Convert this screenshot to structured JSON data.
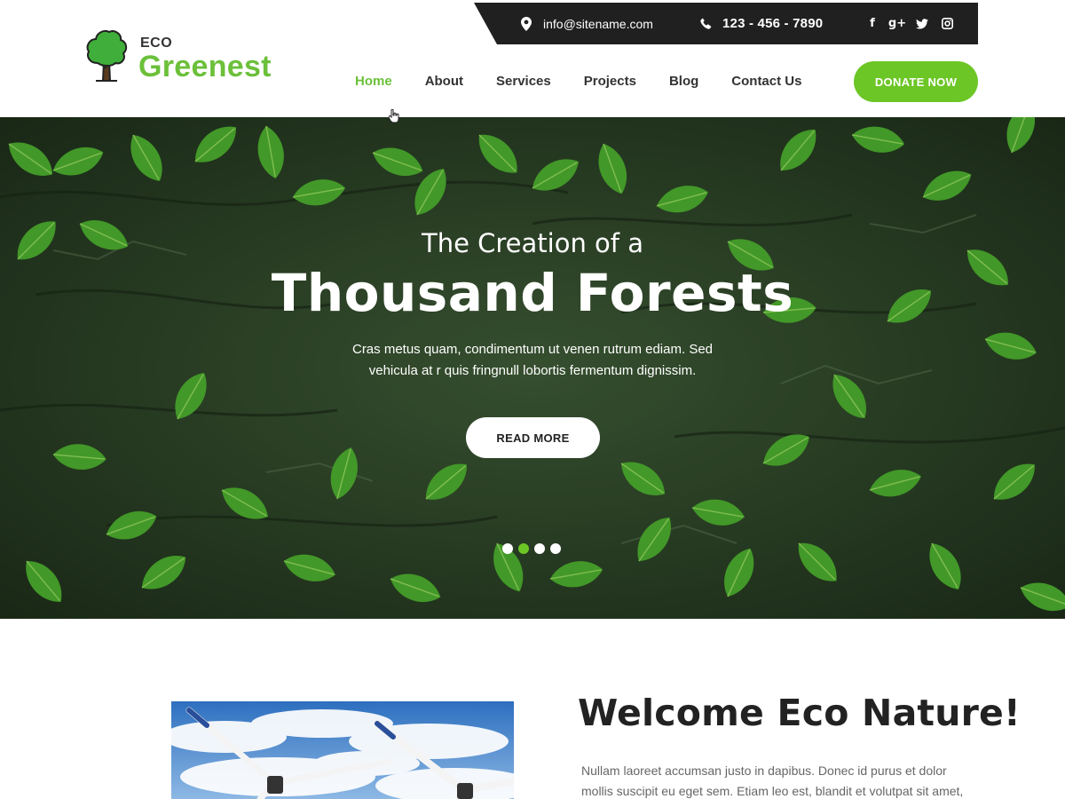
{
  "contact": {
    "email": "info@sitename.com",
    "phone": "123 - 456 - 7890",
    "social": [
      {
        "icon": "facebook-icon",
        "glyph": "f"
      },
      {
        "icon": "google-plus-icon",
        "glyph": "g+"
      },
      {
        "icon": "twitter-icon",
        "glyph": "t"
      },
      {
        "icon": "instagram-icon",
        "glyph": "◘"
      }
    ]
  },
  "logo": {
    "eco": "ECO",
    "brand": "Greenest"
  },
  "nav": {
    "items": [
      {
        "label": "Home",
        "active": true
      },
      {
        "label": "About",
        "active": false
      },
      {
        "label": "Services",
        "active": false
      },
      {
        "label": "Projects",
        "active": false
      },
      {
        "label": "Blog",
        "active": false
      },
      {
        "label": "Contact Us",
        "active": false
      }
    ],
    "donate_label": "DONATE NOW"
  },
  "hero": {
    "subtitle": "The Creation of a",
    "title": "Thousand Forests",
    "text": "Cras metus quam, condimentum ut venen rutrum ediam. Sed vehicula at r quis fringnull lobortis fermentum dignissim.",
    "button_label": "READ MORE",
    "slides": 4,
    "active_slide": 2
  },
  "welcome": {
    "title": "Welcome Eco Nature!",
    "text": "Nullam laoreet accumsan justo in dapibus. Donec id purus et dolor mollis suscipit eu eget sem. Etiam leo est, blandit et volutpat sit amet, varius"
  },
  "colors": {
    "accent": "#6cc626",
    "brand_green": "#6cc03a",
    "dark_bar": "#202020",
    "hero_bg": "#2f4a2a"
  }
}
